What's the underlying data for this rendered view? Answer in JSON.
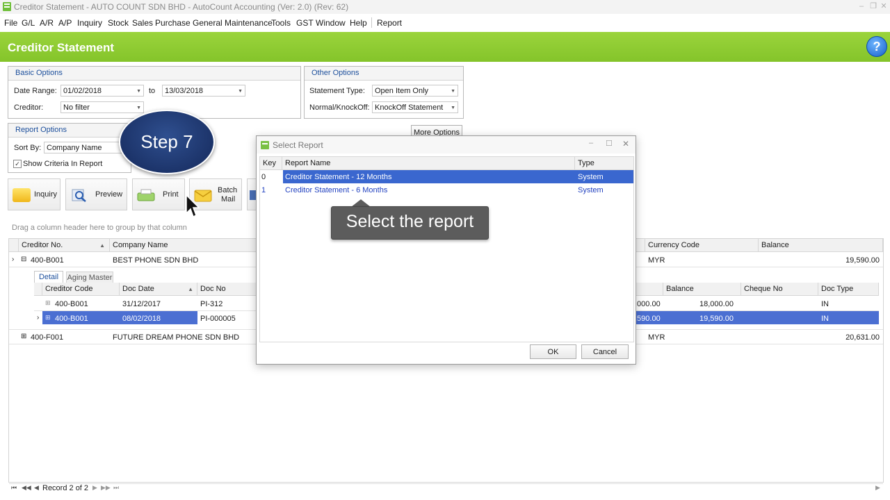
{
  "window": {
    "title": "Creditor Statement - AUTO COUNT SDN BHD - AutoCount Accounting (Ver: 2.0) (Rev: 62)"
  },
  "menu": {
    "items": [
      "File",
      "G/L",
      "A/R",
      "A/P",
      "Inquiry",
      "Stock",
      "Sales",
      "Purchase",
      "General Maintenance",
      "Tools",
      "GST",
      "Window",
      "Help",
      "Report"
    ]
  },
  "header": {
    "title": "Creditor Statement",
    "help_glyph": "?"
  },
  "basic_options": {
    "title": "Basic Options",
    "date_range_label": "Date Range:",
    "date_from": "01/02/2018",
    "to_label": "to",
    "date_to": "13/03/2018",
    "creditor_label": "Creditor:",
    "creditor_value": "No filter"
  },
  "other_options": {
    "title": "Other Options",
    "statement_type_label": "Statement Type:",
    "statement_type_value": "Open Item Only",
    "knockoff_label": "Normal/KnockOff:",
    "knockoff_value": "KnockOff Statement"
  },
  "report_options": {
    "title": "Report Options",
    "sort_by_label": "Sort By:",
    "sort_by_value": "Company Name",
    "show_criteria_label": "Show Criteria In Report",
    "more_options_label": "More Options"
  },
  "toolbar": {
    "inquiry": "Inquiry",
    "preview": "Preview",
    "print": "Print",
    "batch_mail_1": "Batch",
    "batch_mail_2": "Mail"
  },
  "grid": {
    "group_hint": "Drag a column header here to group by that column",
    "headers": {
      "creditor_no": "Creditor No.",
      "company_name": "Company Name",
      "currency_code": "Currency Code",
      "balance": "Balance"
    },
    "rows": [
      {
        "creditor_no": "400-B001",
        "company_name": "BEST PHONE SDN BHD",
        "currency": "MYR",
        "balance": "19,590.00"
      },
      {
        "creditor_no": "400-F001",
        "company_name": "FUTURE DREAM PHONE SDN BHD",
        "currency": "MYR",
        "balance": "20,631.00"
      }
    ],
    "detail": {
      "tabs": [
        "Detail",
        "Aging Master"
      ],
      "headers": {
        "creditor_code": "Creditor Code",
        "doc_date": "Doc Date",
        "doc_no": "Doc No",
        "balance": "Balance",
        "cheque_no": "Cheque No",
        "doc_type": "Doc Type"
      },
      "rows": [
        {
          "creditor_code": "400-B001",
          "doc_date": "31/12/2017",
          "doc_no": "PI-312",
          "partial": ",000.00",
          "balance": "18,000.00",
          "cheque_no": "",
          "doc_type": "IN"
        },
        {
          "creditor_code": "400-B001",
          "doc_date": "08/02/2018",
          "doc_no": "PI-000005",
          "partial": ",590.00",
          "balance": "19,590.00",
          "cheque_no": "",
          "doc_type": "IN"
        }
      ]
    },
    "navigator": {
      "record_text": "Record 2 of 2"
    }
  },
  "dialog": {
    "title": "Select Report",
    "headers": {
      "key": "Key",
      "report_name": "Report Name",
      "type": "Type"
    },
    "rows": [
      {
        "key": "0",
        "report_name": "Creditor Statement - 12 Months",
        "type": "System"
      },
      {
        "key": "1",
        "report_name": "Creditor Statement - 6 Months",
        "type": "System"
      }
    ],
    "ok_label": "OK",
    "cancel_label": "Cancel"
  },
  "overlay": {
    "step_label": "Step 7",
    "callout_text": "Select the report"
  },
  "colors": {
    "header_green": "#8bc832",
    "selection_blue": "#2f63c9",
    "dialog_link_blue": "#1f3fbf",
    "group_title_blue": "#1c4f9c",
    "step_bubble": "#1e3a74"
  }
}
